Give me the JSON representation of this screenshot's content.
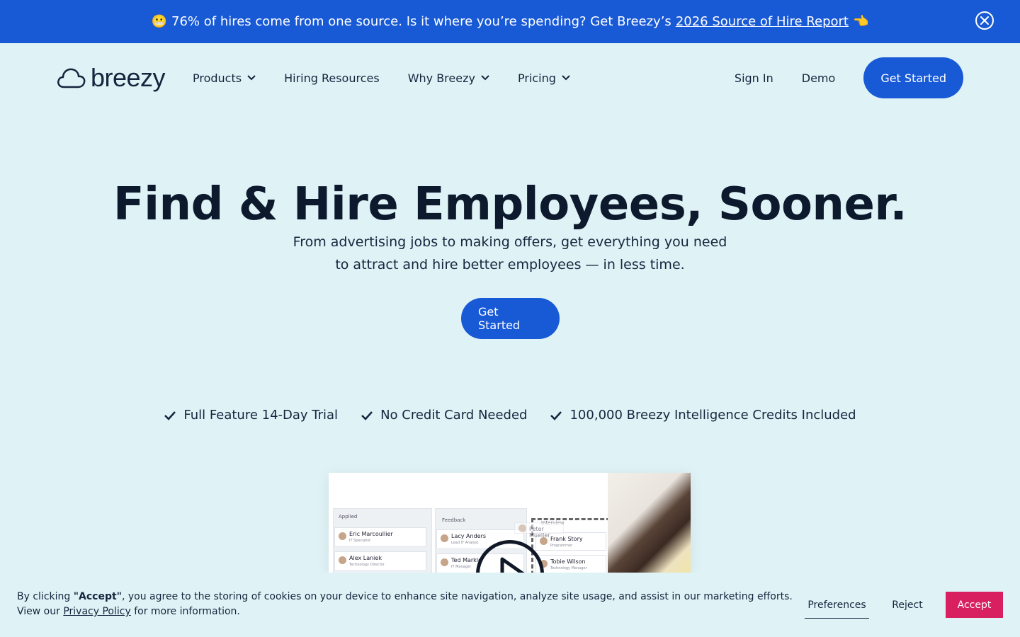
{
  "announcement": {
    "emoji": "😬",
    "text": "76% of hires come from one source. Is it where you’re spending? Get Breezy’s",
    "link_text": "2026 Source of Hire Report",
    "emoji_after": "👈"
  },
  "nav": {
    "logo_text": "breezy",
    "menu": [
      {
        "label": "Products",
        "has_dropdown": true
      },
      {
        "label": "Hiring Resources",
        "has_dropdown": false
      },
      {
        "label": "Why Breezy",
        "has_dropdown": true
      },
      {
        "label": "Pricing",
        "has_dropdown": true
      }
    ],
    "sign_in": "Sign In",
    "demo": "Demo",
    "cta": "Get Started"
  },
  "hero": {
    "title": "Find & Hire Employees, Sooner.",
    "subtitle_line1": "From advertising jobs to making offers, get everything you need",
    "subtitle_line2": "to attract and hire better employees — in less time.",
    "cta": "Get Started"
  },
  "features": [
    "Full Feature 14-Day Trial",
    "No Credit Card Needed",
    "100,000 Breezy Intelligence Credits Included"
  ],
  "preview": {
    "columns": [
      "Applied",
      "Feedback",
      "Interview"
    ],
    "cards": [
      {
        "name": "Eric Marcoullier",
        "role": "IT Specialist"
      },
      {
        "name": "Alex Laniek",
        "role": "Technology Director"
      },
      {
        "name": "Lacy Anders",
        "role": "Lead IT Analyst"
      },
      {
        "name": "Ted Markle",
        "role": "IT Manager"
      },
      {
        "name": "Frank Story",
        "role": "Programmer"
      },
      {
        "name": "Tobie Wilson",
        "role": "Technology Manager"
      },
      {
        "name": "Peter Mueller",
        "role": ""
      }
    ]
  },
  "cookie": {
    "prefix": "By clicking ",
    "accept_quoted": "\"Accept\"",
    "body": ", you agree to the storing of cookies on your device to enhance site navigation, analyze site usage, and assist in our marketing efforts.",
    "line2_prefix": "View our ",
    "privacy_link": "Privacy Policy",
    "line2_suffix": " for more information.",
    "preferences": "Preferences",
    "reject": "Reject",
    "accept": "Accept"
  },
  "colors": {
    "primary": "#1859d6",
    "background": "#dff2f6",
    "accept": "#d81f5f"
  }
}
